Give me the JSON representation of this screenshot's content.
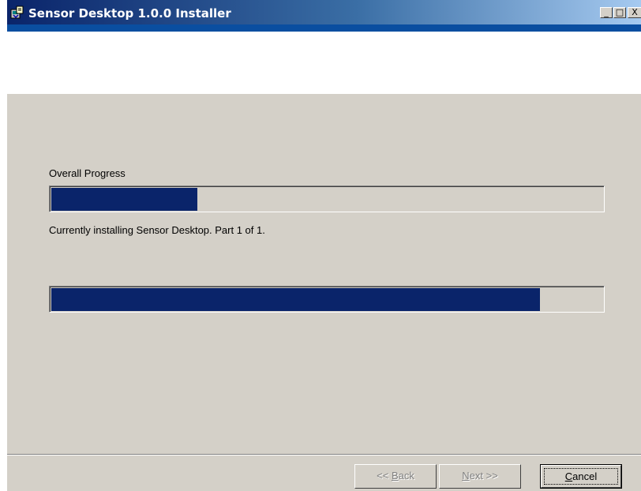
{
  "window": {
    "title": "Sensor Desktop 1.0.0 Installer",
    "controls": {
      "minimize": "_",
      "maximize": "□",
      "close": "X"
    }
  },
  "overall": {
    "label": "Overall Progress",
    "progress_fraction": 0.265
  },
  "status": {
    "text": "Currently installing Sensor Desktop.  Part 1 of 1."
  },
  "current": {
    "progress_fraction": 0.885
  },
  "buttons": {
    "back": {
      "prefix": "<< ",
      "mnemonic": "B",
      "rest": "ack",
      "enabled": false
    },
    "next": {
      "mnemonic": "N",
      "rest": "ext >>",
      "enabled": false
    },
    "cancel": {
      "mnemonic": "C",
      "rest": "ancel",
      "enabled": true
    }
  },
  "icons": {
    "app": "installer-icon"
  },
  "colors": {
    "title_start": "#0a246a",
    "title_end": "#a6caf0",
    "progress_fill": "#0a246a",
    "dialog_bg": "#d4d0c8"
  }
}
